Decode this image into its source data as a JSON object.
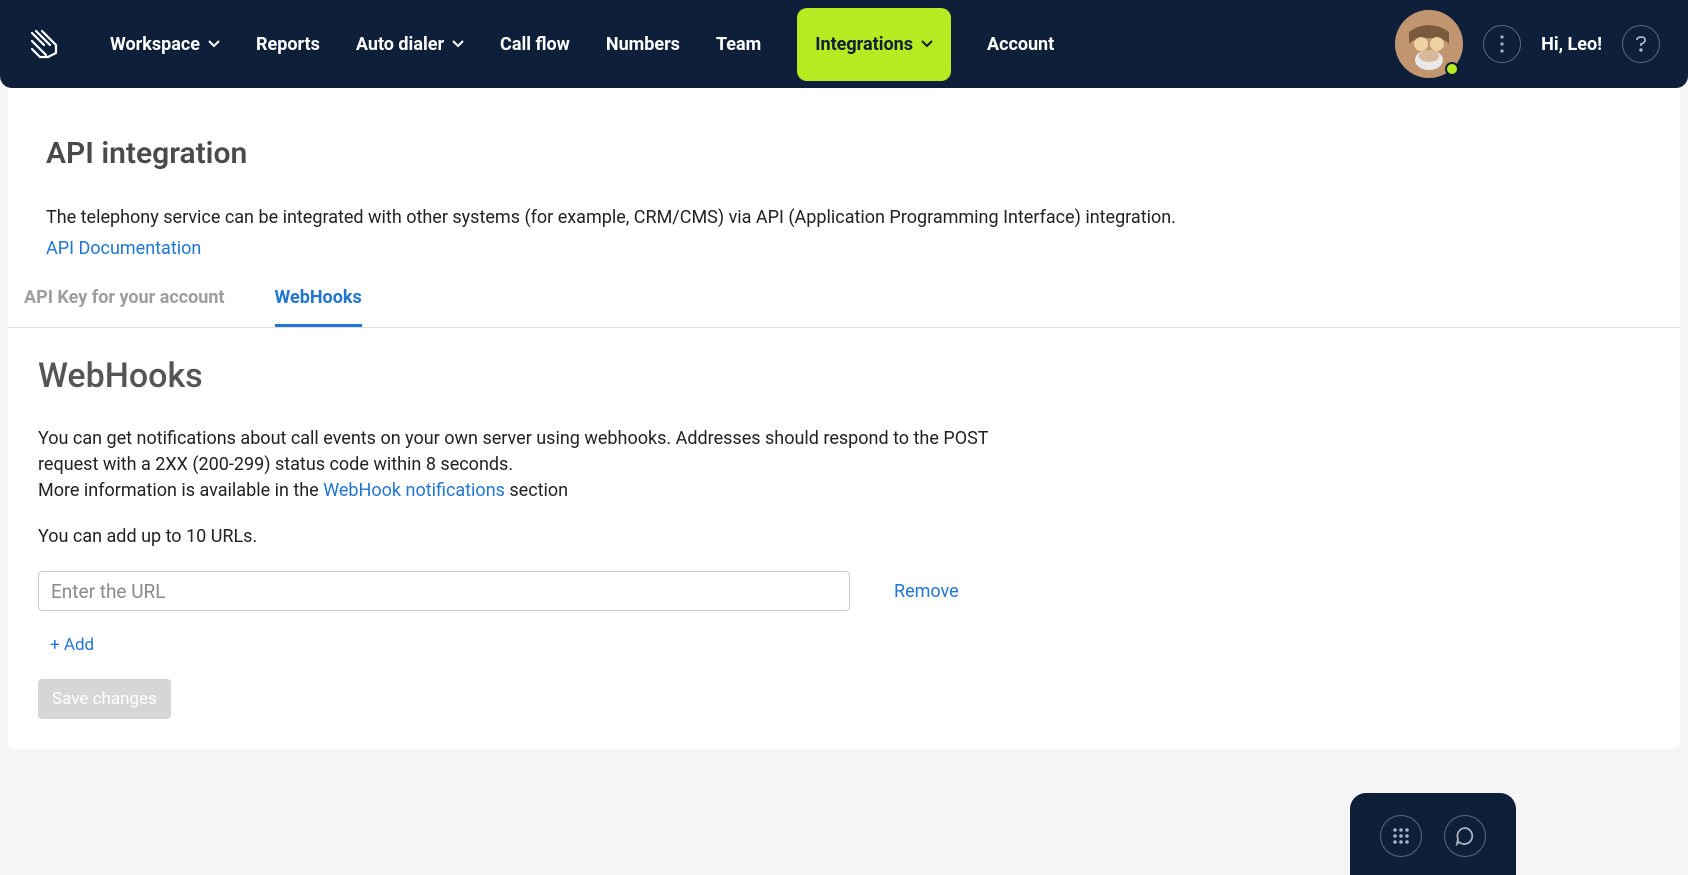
{
  "nav": {
    "workspace": "Workspace",
    "reports": "Reports",
    "autodialer": "Auto dialer",
    "callflow": "Call flow",
    "numbers": "Numbers",
    "team": "Team",
    "integrations": "Integrations",
    "account": "Account"
  },
  "greeting": "Hi, Leo!",
  "page": {
    "title": "API integration",
    "description": "The telephony service can be integrated with other systems (for example, CRM/CMS) via API (Application Programming Interface) integration.",
    "doc_link": "API Documentation"
  },
  "tabs": {
    "apikey": "API Key for your account",
    "webhooks": "WebHooks"
  },
  "webhooks": {
    "title": "WebHooks",
    "text1": "You can get notifications about call events on your own server using webhooks. Addresses should respond to the POST request with a 2XX (200-299) status code within 8 seconds.",
    "text2a": "More information is available in the ",
    "text2_link": "WebHook notifications",
    "text2b": " section",
    "limit": "You can add up to 10 URLs.",
    "placeholder": "Enter the URL",
    "remove": "Remove",
    "add": "+ Add",
    "save": "Save changes"
  }
}
